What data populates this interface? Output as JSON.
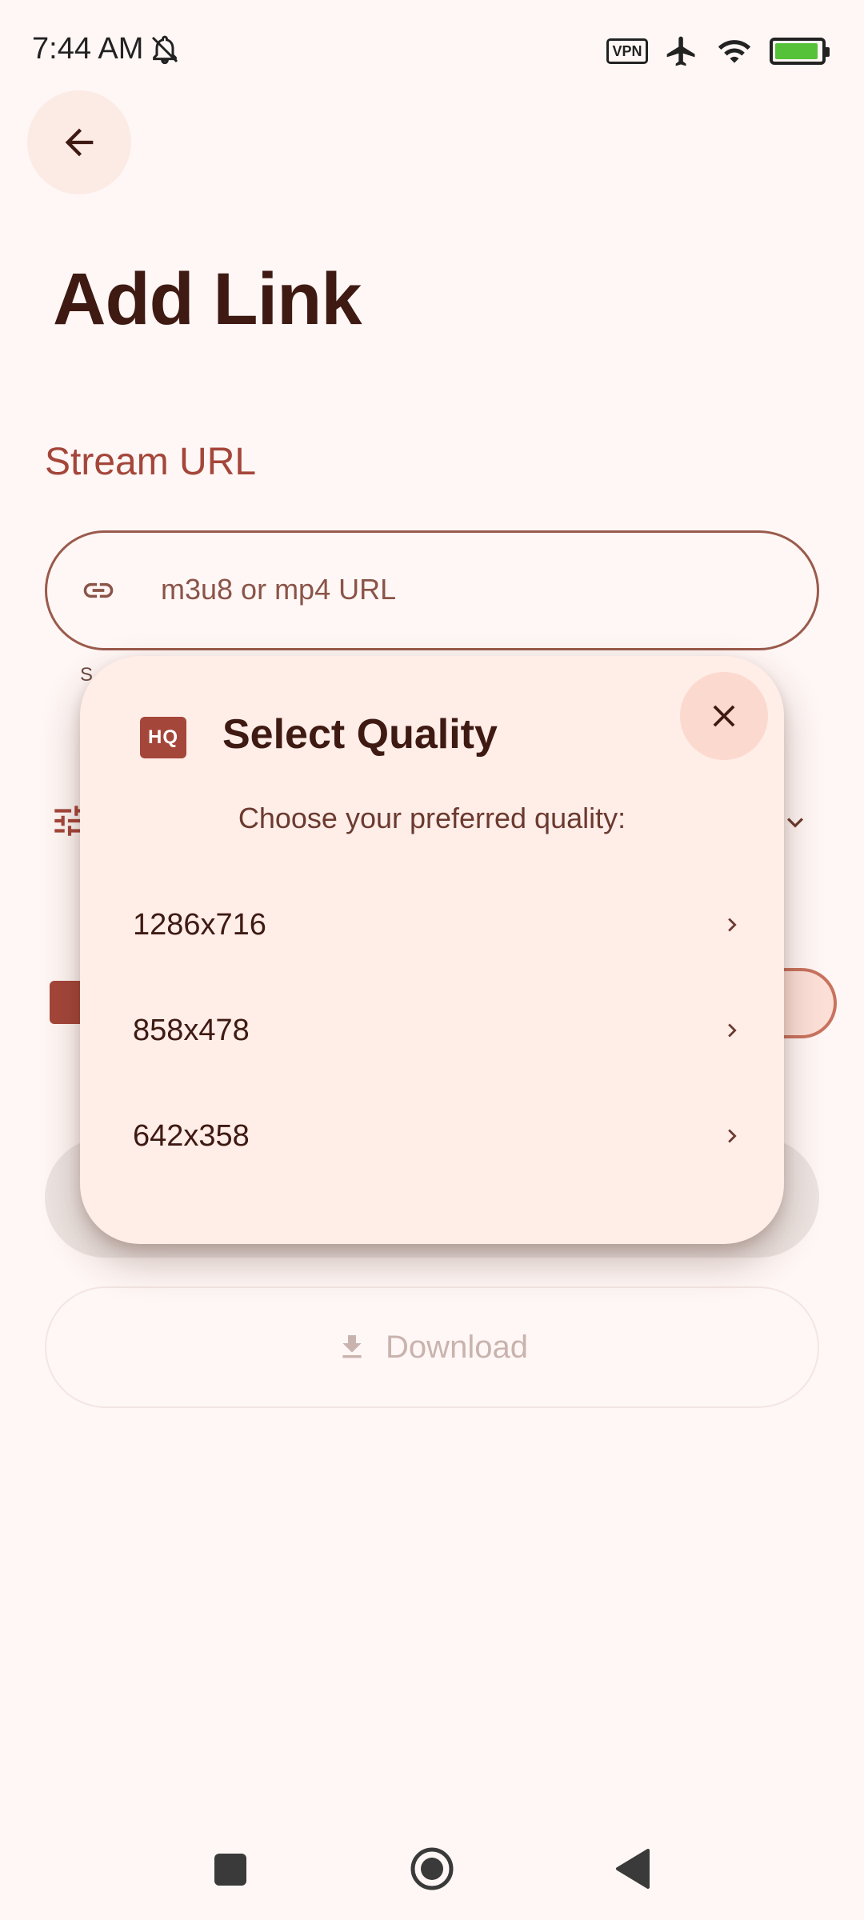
{
  "status_bar": {
    "time": "7:44 AM",
    "vpn_label": "VPN",
    "icons": [
      "bell-off-icon",
      "vpn-icon",
      "airplane-icon",
      "wifi-icon",
      "battery-charging-icon"
    ]
  },
  "header": {
    "back_icon": "arrow-left-icon",
    "title": "Add Link"
  },
  "form": {
    "section_label": "Stream URL",
    "url_placeholder": "m3u8 or mp4 URL",
    "url_value": "",
    "helper_text": "S",
    "download_label": "Download"
  },
  "dialog": {
    "icon_label": "HQ",
    "title": "Select Quality",
    "subtitle": "Choose your preferred quality:",
    "options": [
      {
        "label": "1286x716"
      },
      {
        "label": "858x478"
      },
      {
        "label": "642x358"
      }
    ]
  },
  "colors": {
    "background": "#FFF7F5",
    "accent": "#A4463A",
    "dialog": "#FFEDE8",
    "text_dark": "#3E1A12"
  }
}
